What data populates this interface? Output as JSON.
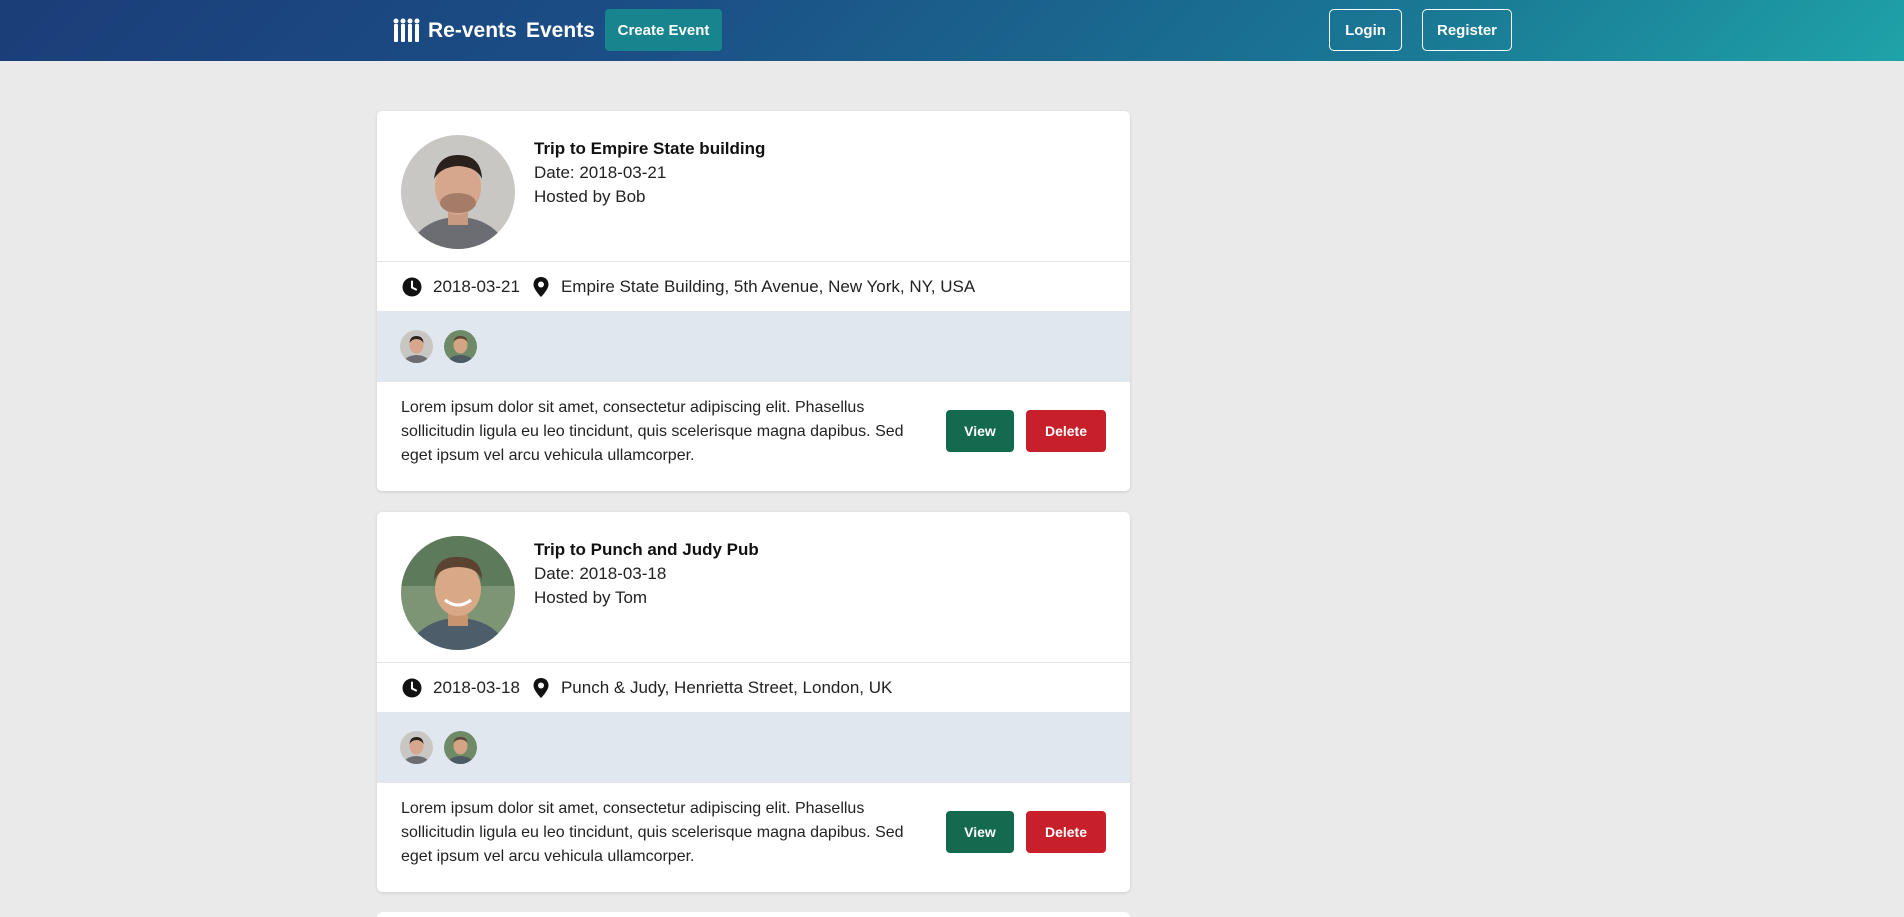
{
  "navbar": {
    "brand": "Re-vents",
    "events_link": "Events",
    "create_event": "Create Event",
    "login": "Login",
    "register": "Register",
    "gradient_start": "#1b3d78",
    "gradient_end": "#1fa3a8"
  },
  "events": [
    {
      "title": "Trip to Empire State building",
      "date_line": "Date: 2018-03-21",
      "host_line": "Hosted by Bob",
      "date": "2018-03-21",
      "venue": "Empire State Building, 5th Avenue, New York, NY, USA",
      "description": "Lorem ipsum dolor sit amet, consectetur adipiscing elit. Phasellus sollicitudin ligula eu leo tincidunt, quis scelerisque magna dapibus. Sed eget ipsum vel arcu vehicula ullamcorper.",
      "view_label": "View",
      "delete_label": "Delete"
    },
    {
      "title": "Trip to Punch and Judy Pub",
      "date_line": "Date: 2018-03-18",
      "host_line": "Hosted by Tom",
      "date": "2018-03-18",
      "venue": "Punch & Judy, Henrietta Street, London, UK",
      "description": "Lorem ipsum dolor sit amet, consectetur adipiscing elit. Phasellus sollicitudin ligula eu leo tincidunt, quis scelerisque magna dapibus. Sed eget ipsum vel arcu vehicula ullamcorper.",
      "view_label": "View",
      "delete_label": "Delete"
    }
  ],
  "colors": {
    "page_bg": "#eaeaea",
    "attendee_bar": "#e1e7ef",
    "view_button": "#136a4e",
    "delete_button": "#c8202b",
    "create_button": "#17848e"
  },
  "icons": {
    "logo": "people-logo-icon",
    "clock": "clock-icon",
    "pin": "map-pin-icon"
  }
}
